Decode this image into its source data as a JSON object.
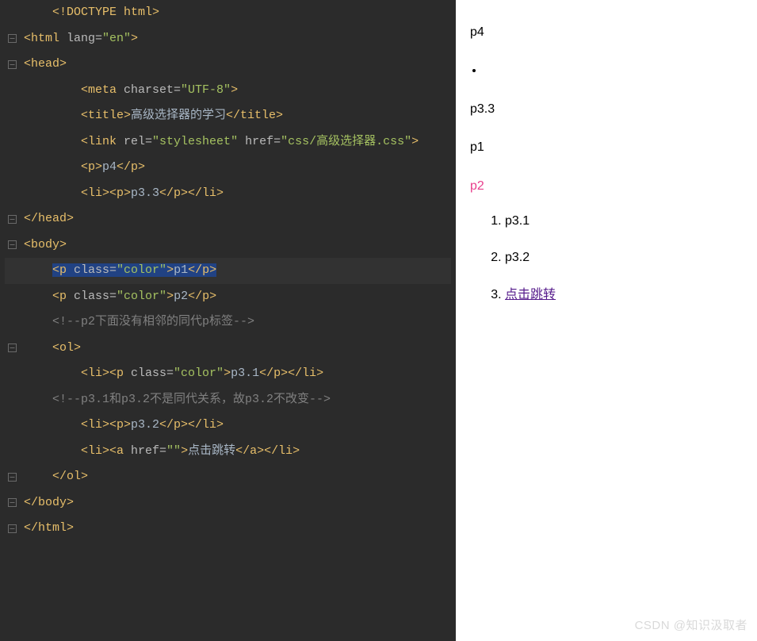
{
  "editor": {
    "lines": [
      {
        "fold": null,
        "indent": 1,
        "tokens": [
          {
            "c": "doctype",
            "t": "<!DOCTYPE html>"
          }
        ]
      },
      {
        "fold": "open",
        "indent": 0,
        "tokens": [
          {
            "c": "tag",
            "t": "<html "
          },
          {
            "c": "attr-name",
            "t": "lang="
          },
          {
            "c": "attr-val",
            "t": "\"en\""
          },
          {
            "c": "tag",
            "t": ">"
          }
        ]
      },
      {
        "fold": "open",
        "indent": 0,
        "tokens": [
          {
            "c": "tag",
            "t": "<head>"
          }
        ]
      },
      {
        "fold": null,
        "indent": 2,
        "tokens": [
          {
            "c": "tag",
            "t": "<meta "
          },
          {
            "c": "attr-name",
            "t": "charset="
          },
          {
            "c": "attr-val",
            "t": "\"UTF-8\""
          },
          {
            "c": "tag",
            "t": ">"
          }
        ]
      },
      {
        "fold": null,
        "indent": 2,
        "tokens": [
          {
            "c": "tag",
            "t": "<title>"
          },
          {
            "c": "txt",
            "t": "高级选择器的学习"
          },
          {
            "c": "tag",
            "t": "</title>"
          }
        ]
      },
      {
        "fold": null,
        "indent": 2,
        "tokens": [
          {
            "c": "tag",
            "t": "<link "
          },
          {
            "c": "attr-name",
            "t": "rel="
          },
          {
            "c": "attr-val",
            "t": "\"stylesheet\""
          },
          {
            "c": "tag",
            "t": " "
          },
          {
            "c": "attr-name",
            "t": "href="
          },
          {
            "c": "attr-val",
            "t": "\"css/高级选择器.css\""
          },
          {
            "c": "tag",
            "t": ">"
          }
        ]
      },
      {
        "fold": null,
        "indent": 2,
        "tokens": [
          {
            "c": "tag",
            "t": "<p>"
          },
          {
            "c": "txt",
            "t": "p4"
          },
          {
            "c": "tag",
            "t": "</p>"
          }
        ]
      },
      {
        "fold": null,
        "indent": 2,
        "tokens": [
          {
            "c": "tag",
            "t": "<li><p>"
          },
          {
            "c": "txt",
            "t": "p3.3"
          },
          {
            "c": "tag",
            "t": "</p></li>"
          }
        ]
      },
      {
        "fold": "close",
        "indent": 0,
        "tokens": [
          {
            "c": "tag",
            "t": "</head>"
          }
        ]
      },
      {
        "fold": null,
        "indent": 0,
        "tokens": [
          {
            "c": "txt",
            "t": ""
          }
        ]
      },
      {
        "fold": "open",
        "indent": 0,
        "tokens": [
          {
            "c": "tag",
            "t": "<body>"
          }
        ]
      },
      {
        "fold": null,
        "hl": true,
        "indent": 1,
        "tokens": [
          {
            "c": "tag",
            "sel": true,
            "t": "<p "
          },
          {
            "c": "attr-name",
            "sel": true,
            "t": "class="
          },
          {
            "c": "attr-val",
            "sel": true,
            "t": "\"color\""
          },
          {
            "c": "tag",
            "sel": true,
            "t": ">"
          },
          {
            "c": "txt",
            "sel": true,
            "t": "p1"
          },
          {
            "c": "tag",
            "sel": true,
            "t": "</p>"
          }
        ]
      },
      {
        "fold": null,
        "indent": 1,
        "tokens": [
          {
            "c": "tag",
            "t": "<p "
          },
          {
            "c": "attr-name",
            "t": "class="
          },
          {
            "c": "attr-val",
            "t": "\"color\""
          },
          {
            "c": "tag",
            "t": ">"
          },
          {
            "c": "txt",
            "t": "p2"
          },
          {
            "c": "tag",
            "t": "</p>"
          }
        ]
      },
      {
        "fold": null,
        "indent": 1,
        "tokens": [
          {
            "c": "comment",
            "t": "<!--p2下面没有相邻的同代p标签-->"
          }
        ]
      },
      {
        "fold": "open",
        "indent": 1,
        "tokens": [
          {
            "c": "tag",
            "t": "<ol>"
          }
        ]
      },
      {
        "fold": null,
        "indent": 2,
        "tokens": [
          {
            "c": "tag",
            "t": "<li><p "
          },
          {
            "c": "attr-name",
            "t": "class="
          },
          {
            "c": "attr-val",
            "t": "\"color\""
          },
          {
            "c": "tag",
            "t": ">"
          },
          {
            "c": "txt",
            "t": "p3.1"
          },
          {
            "c": "tag",
            "t": "</p></li>"
          }
        ]
      },
      {
        "fold": null,
        "indent": 1,
        "tokens": [
          {
            "c": "comment",
            "t": "<!--p3.1和p3.2不是同代关系，故p3.2不改变-->"
          }
        ]
      },
      {
        "fold": null,
        "indent": 2,
        "tokens": [
          {
            "c": "tag",
            "t": "<li><p>"
          },
          {
            "c": "txt",
            "t": "p3.2"
          },
          {
            "c": "tag",
            "t": "</p></li>"
          }
        ]
      },
      {
        "fold": null,
        "indent": 2,
        "tokens": [
          {
            "c": "tag",
            "t": "<li><a "
          },
          {
            "c": "attr-name",
            "t": "href="
          },
          {
            "c": "attr-val",
            "t": "\"\""
          },
          {
            "c": "tag",
            "t": ">"
          },
          {
            "c": "txt",
            "t": "点击跳转"
          },
          {
            "c": "tag",
            "t": "</a></li>"
          }
        ]
      },
      {
        "fold": "close",
        "indent": 1,
        "tokens": [
          {
            "c": "tag",
            "t": "</ol>"
          }
        ]
      },
      {
        "fold": "close",
        "indent": 0,
        "tokens": [
          {
            "c": "tag",
            "t": "</body>"
          }
        ]
      },
      {
        "fold": "close",
        "indent": 0,
        "tokens": [
          {
            "c": "tag",
            "t": "</html>"
          }
        ]
      }
    ]
  },
  "preview": {
    "p4": "p4",
    "p33": "p3.3",
    "p1": "p1",
    "p2": "p2",
    "ol": [
      {
        "text": "p3.1",
        "type": "text"
      },
      {
        "text": "p3.2",
        "type": "text"
      },
      {
        "text": "点击跳转",
        "type": "link"
      }
    ]
  },
  "watermark": "CSDN @知识汲取者"
}
